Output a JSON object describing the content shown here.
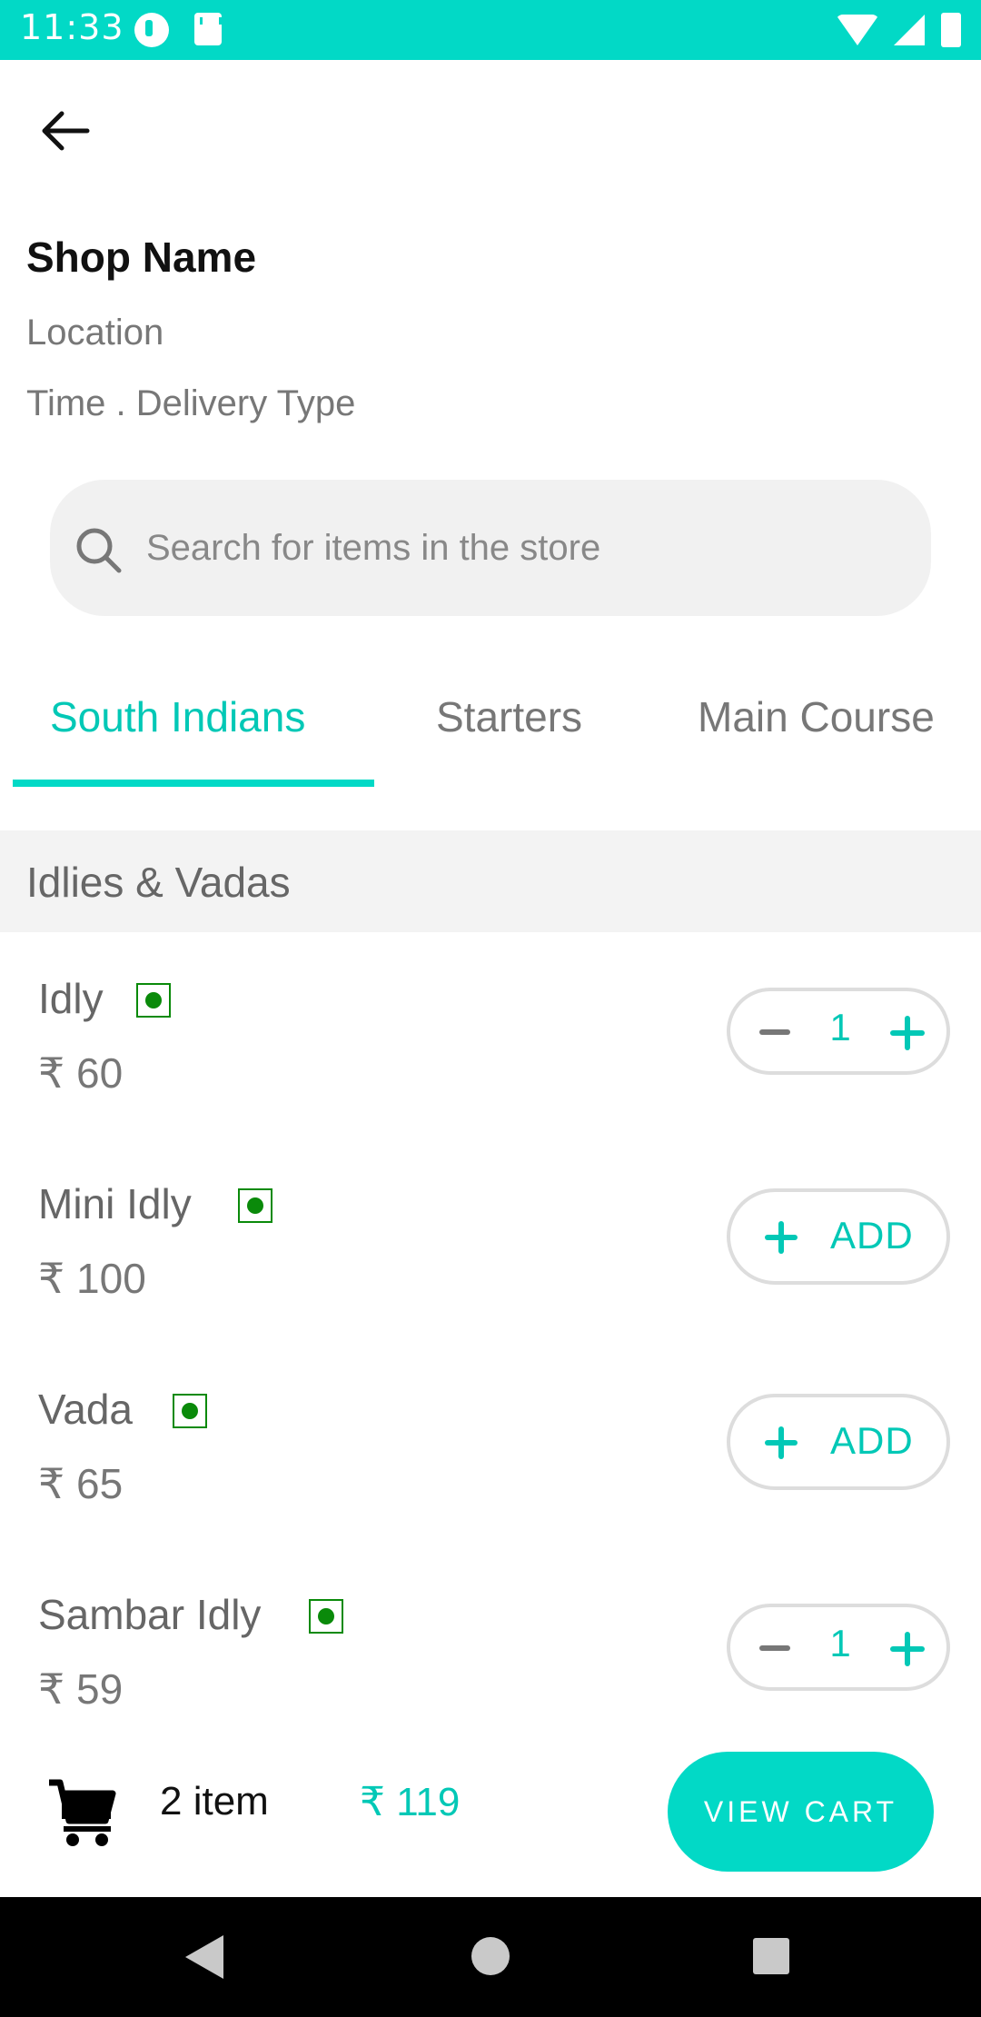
{
  "status_bar": {
    "time": "11:33",
    "icons": [
      "app-notification-icon",
      "sd-card-icon",
      "wifi-icon",
      "signal-icon",
      "battery-icon"
    ]
  },
  "header": {
    "back_icon": "arrow-left-icon",
    "shop_name": "Shop Name",
    "location": "Location",
    "meta": "Time . Delivery Type"
  },
  "search": {
    "icon": "search-icon",
    "placeholder": "Search for items in the store"
  },
  "tabs": [
    {
      "label": "South Indians",
      "selected": true
    },
    {
      "label": "Starters",
      "selected": false
    },
    {
      "label": "Main Course",
      "selected": false
    }
  ],
  "category": {
    "title": "Idlies & Vadas"
  },
  "items": [
    {
      "name": "Idly",
      "price": "₹ 60",
      "veg": true,
      "quantity": "1"
    },
    {
      "name": "Mini Idly",
      "price": "₹ 100",
      "veg": true,
      "action_label": "ADD"
    },
    {
      "name": "Vada",
      "price": "₹ 65",
      "veg": true,
      "action_label": "ADD"
    },
    {
      "name": "Sambar Idly",
      "price": "₹ 59",
      "veg": true,
      "quantity": "1"
    }
  ],
  "cart": {
    "icon": "shopping-cart-icon",
    "count_label": "2 item",
    "total": "₹ 119",
    "button_label": "VIEW CART"
  },
  "colors": {
    "accent": "#02D9C6",
    "veg_green": "#0A8A0A"
  }
}
